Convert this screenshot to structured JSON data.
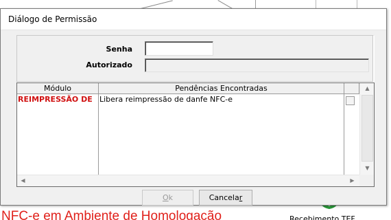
{
  "dialog": {
    "title": "Diálogo de Permissão",
    "senha_label": "Senha",
    "senha_value": "",
    "autorizado_label": "Autorizado",
    "autorizado_value": ""
  },
  "grid": {
    "columns": [
      "Módulo",
      "Pendências Encontradas",
      ""
    ],
    "rows": [
      {
        "modulo": "REIMPRESSÃO DE",
        "pendencia": "Libera reimpressão de danfe NFC-e",
        "checked": false
      }
    ]
  },
  "buttons": {
    "ok_prefix": "",
    "ok_underline": "O",
    "ok_suffix": "k",
    "cancel_prefix": "Cancela",
    "cancel_underline": "r",
    "cancel_suffix": ""
  },
  "background": {
    "banner_text": "NFC-e em Ambiente de Homologação",
    "right_caption": "Recebimento TEF"
  },
  "colors": {
    "modulo_text": "#d01010",
    "banner_text": "#e0201a",
    "dialog_bg": "#f0f0f0"
  }
}
